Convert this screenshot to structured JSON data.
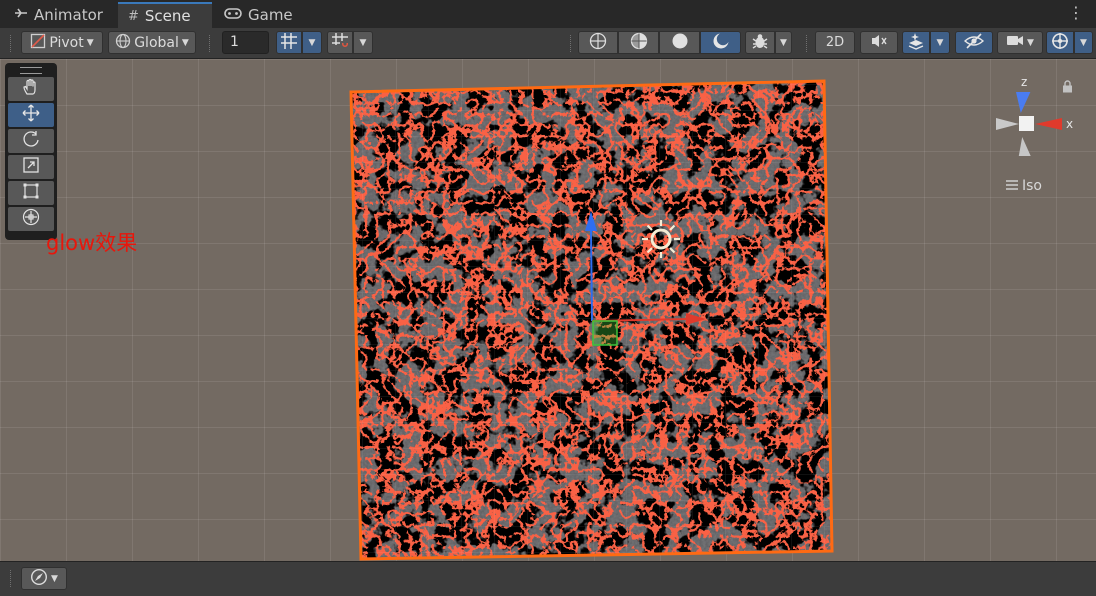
{
  "tabs": [
    {
      "label": "Animator",
      "icon": "animator-icon"
    },
    {
      "label": "Scene",
      "icon": "scene-grid-icon"
    },
    {
      "label": "Game",
      "icon": "gamepad-icon"
    }
  ],
  "menu_icon": "kebab-menu-icon",
  "toolbar": {
    "pivot_label": "Pivot",
    "global_label": "Global",
    "grid_value": "1",
    "mode_2d_label": "2D"
  },
  "viewport": {
    "annotation_text": "glow效果",
    "gizmo": {
      "x_label": "x",
      "z_label": "z",
      "projection_label": "Iso"
    }
  },
  "colors": {
    "selection_outline": "#ff6a13",
    "annotation": "#e8160b",
    "axis_x": "#e03a2c",
    "axis_y": "#2f6ef0",
    "axis_z": "#4a7cf0",
    "accent_button": "#3f5f87"
  }
}
